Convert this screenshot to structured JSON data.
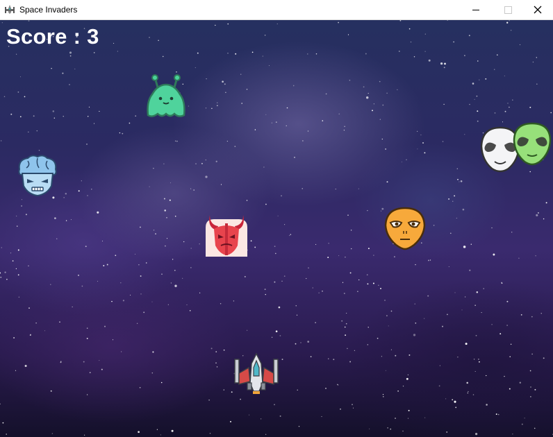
{
  "window": {
    "title": "Space Invaders",
    "icon": "spaceship-icon",
    "controls": [
      "minimize-icon",
      "maximize-icon",
      "close-icon"
    ]
  },
  "game": {
    "score_text": "Score : 3",
    "score": 3,
    "player": {
      "icon": "spaceship-player-icon"
    },
    "enemies": [
      {
        "icon": "green-blob-alien-icon"
      },
      {
        "icon": "blue-brain-alien-icon"
      },
      {
        "icon": "red-horned-devil-icon"
      },
      {
        "icon": "orange-alien-face-icon"
      },
      {
        "icon": "white-alien-face-icon"
      },
      {
        "icon": "green-alien-face-icon"
      }
    ]
  }
}
